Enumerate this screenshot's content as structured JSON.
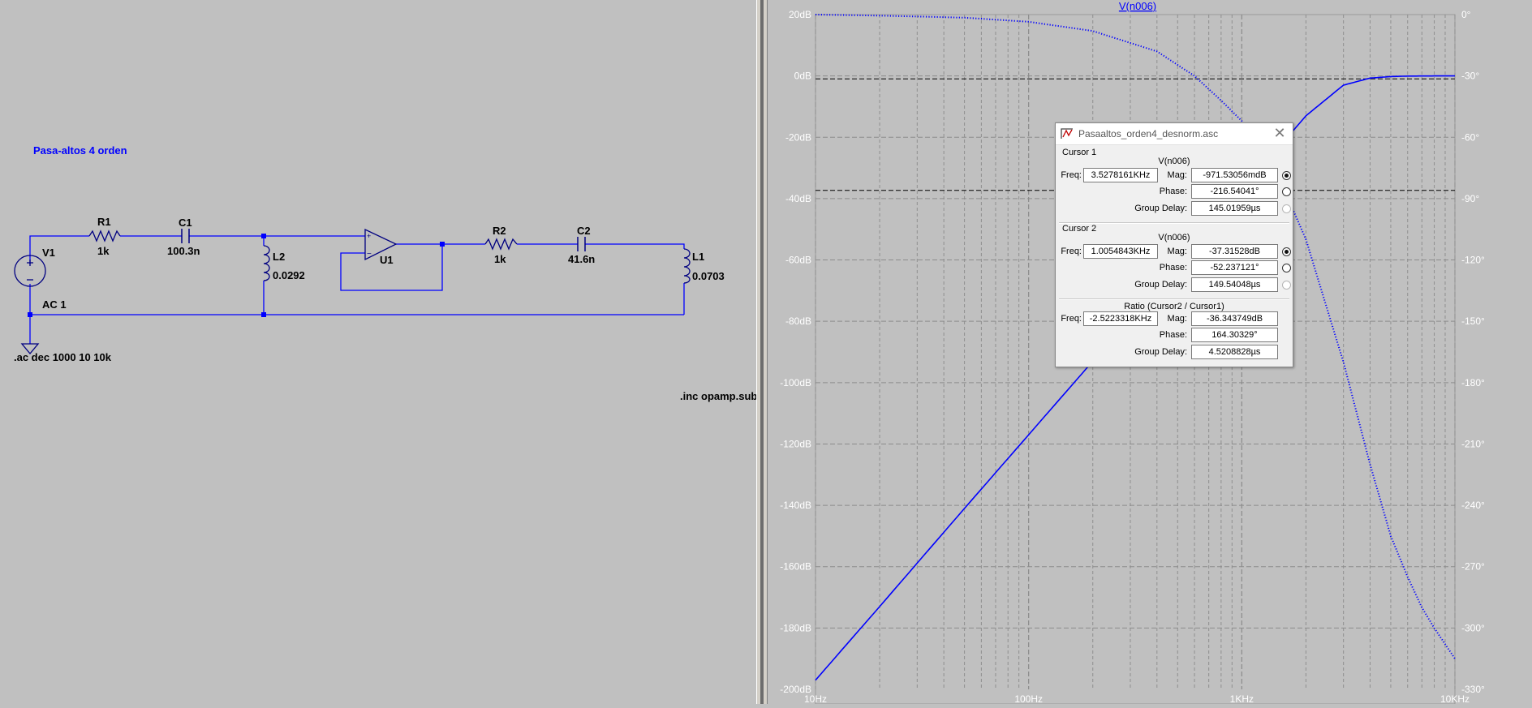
{
  "schematic": {
    "title_text": "Pasa-altos 4 orden",
    "directive_ac": ".ac dec 1000 10 10k",
    "directive_inc": ".inc opamp.sub",
    "components": {
      "v1_name": "V1",
      "v1_value": "AC 1",
      "r1_name": "R1",
      "r1_value": "1k",
      "c1_name": "C1",
      "c1_value": "100.3n",
      "l2_name": "L2",
      "l2_value": "0.0292",
      "u1_name": "U1",
      "r2_name": "R2",
      "r2_value": "1k",
      "c2_name": "C2",
      "c2_value": "41.6n",
      "l1_name": "L1",
      "l1_value": "0.0703"
    }
  },
  "plot": {
    "trace_label": "V(n006)",
    "trace_color": "#0000ff",
    "left_axis_ticks": [
      "20dB",
      "0dB",
      "-20dB",
      "-40dB",
      "-60dB",
      "-80dB",
      "-100dB",
      "-120dB",
      "-140dB",
      "-160dB",
      "-180dB",
      "-200dB"
    ],
    "right_axis_ticks": [
      "0°",
      "-30°",
      "-60°",
      "-90°",
      "-120°",
      "-150°",
      "-180°",
      "-210°",
      "-240°",
      "-270°",
      "-300°",
      "-330°"
    ],
    "x_axis_ticks": [
      "10Hz",
      "100Hz",
      "1KHz",
      "10KHz"
    ]
  },
  "chart_data": {
    "type": "line",
    "x_scale": "log",
    "xlim": [
      10,
      10000
    ],
    "ylim_left": [
      -200,
      20
    ],
    "ylim_right": [
      -330,
      0
    ],
    "grid": true,
    "series": [
      {
        "name": "V(n006)",
        "axis": "left",
        "style": "solid",
        "x": [
          10,
          20,
          50,
          100,
          200,
          500,
          1000,
          2000,
          3000,
          4000,
          5000,
          6000,
          8000,
          10000
        ],
        "y": [
          -197,
          -173,
          -141,
          -117,
          -93,
          -61,
          -37.3,
          -13,
          -3,
          -0.7,
          -0.2,
          -0.05,
          0,
          0
        ]
      },
      {
        "name": "Phase",
        "axis": "right",
        "style": "dotted",
        "x": [
          10,
          20,
          50,
          100,
          200,
          400,
          600,
          800,
          1000,
          1500,
          2000,
          3000,
          4000,
          5000,
          6000,
          7000,
          8000,
          10000
        ],
        "y": [
          0,
          -0.5,
          -1.5,
          -3.5,
          -8,
          -18,
          -30,
          -42,
          -52,
          -80,
          -110,
          -170,
          -220,
          -255,
          -275,
          -290,
          -300,
          -315
        ]
      }
    ]
  },
  "cursor_dialog": {
    "title": "Pasaaltos_orden4_desnorm.asc",
    "close_glyph": "✕",
    "cursor1": {
      "header": "Cursor 1",
      "trace": "V(n006)",
      "freq_label": "Freq:",
      "freq": "3.5278161KHz",
      "mag_label": "Mag:",
      "mag": "-971.53056mdB",
      "phase_label": "Phase:",
      "phase": "-216.54041°",
      "gd_label": "Group Delay:",
      "gd": "145.01959µs"
    },
    "cursor2": {
      "header": "Cursor 2",
      "trace": "V(n006)",
      "freq_label": "Freq:",
      "freq": "1.0054843KHz",
      "mag_label": "Mag:",
      "mag": "-37.31528dB",
      "phase_label": "Phase:",
      "phase": "-52.237121°",
      "gd_label": "Group Delay:",
      "gd": "149.54048µs"
    },
    "ratio": {
      "header": "Ratio (Cursor2 / Cursor1)",
      "freq_label": "Freq:",
      "freq": "-2.5223318KHz",
      "mag_label": "Mag:",
      "mag": "-36.343749dB",
      "phase_label": "Phase:",
      "phase": "164.30329°",
      "gd_label": "Group Delay:",
      "gd": "4.5208828µs"
    }
  }
}
